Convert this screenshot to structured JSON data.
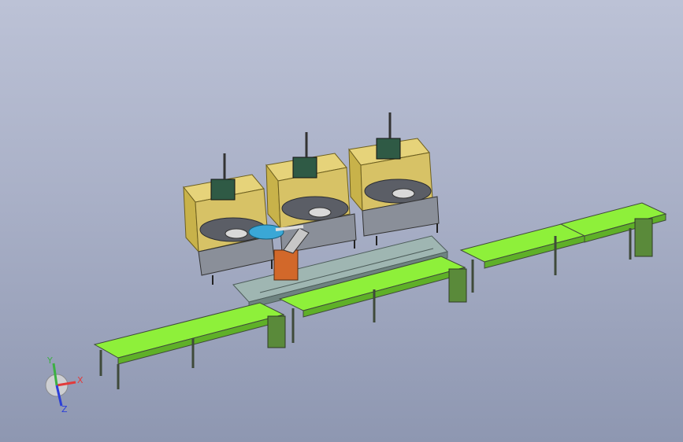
{
  "scene": {
    "type": "cad-assembly-3d-view",
    "colors": {
      "background_top": "#bcc2d6",
      "background_bottom": "#8e97b1",
      "cabinet_frame": "#c8b24a",
      "cabinet_panel": "#e6d37a",
      "conveyor_belt": "#8ef03a",
      "conveyor_frame": "#3f4a3a",
      "rail": "#9fb6b2",
      "robot_accent": "#d2682a",
      "disc": "#3aa7d6"
    },
    "stations_count": 3,
    "conveyor_segments": 4
  },
  "triad": {
    "x_label": "X",
    "y_label": "Y",
    "z_label": "Z",
    "x_color": "#e23b3b",
    "y_color": "#3cb043",
    "z_color": "#2c3fd8"
  }
}
